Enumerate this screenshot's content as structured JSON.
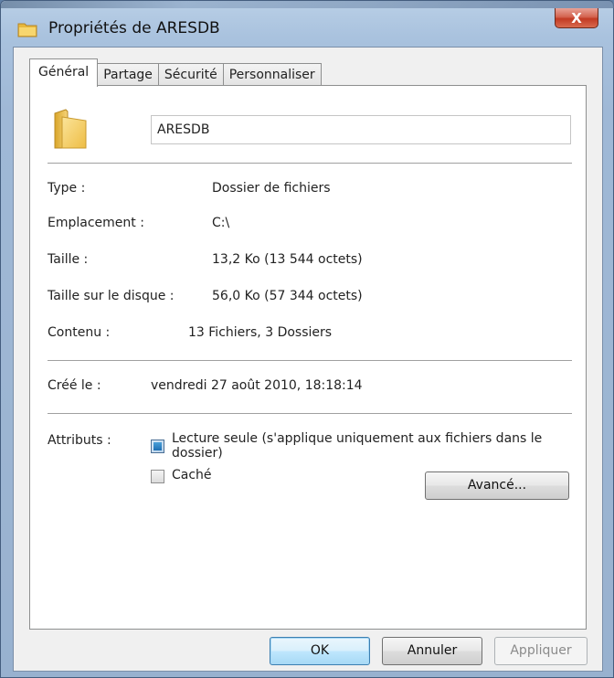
{
  "window": {
    "title": "Propriétés de ARESDB",
    "close_glyph": "X"
  },
  "tabs": [
    {
      "label": "Général",
      "active": true
    },
    {
      "label": "Partage",
      "active": false
    },
    {
      "label": "Sécurité",
      "active": false
    },
    {
      "label": "Personnaliser",
      "active": false
    }
  ],
  "general": {
    "icon": "folder-icon",
    "name_value": "ARESDB",
    "rows": [
      {
        "label": "Type :",
        "value": "Dossier de fichiers"
      },
      {
        "label": "Emplacement :",
        "value": "C:\\"
      },
      {
        "label": "Taille :",
        "value": "13,2 Ko (13 544 octets)"
      },
      {
        "label": "Taille sur le disque :",
        "value": "56,0 Ko (57 344 octets)"
      },
      {
        "label": "Contenu :",
        "value": "13 Fichiers, 3 Dossiers"
      }
    ],
    "created": {
      "label": "Créé le :",
      "value": "vendredi 27 août 2010, 18:18:14"
    },
    "attributes": {
      "label": "Attributs :",
      "readonly_line1": "Lecture seule (s'applique uniquement aux fichiers dans le",
      "readonly_line2": "dossier)",
      "readonly_state": "indeterminate",
      "hidden": "Caché",
      "hidden_state": "unchecked",
      "advanced": "Avancé..."
    }
  },
  "buttons": {
    "ok": "OK",
    "cancel": "Annuler",
    "apply": "Appliquer"
  },
  "colors": {
    "accent": "#3c7fb1",
    "folder": "#f2c94c"
  }
}
